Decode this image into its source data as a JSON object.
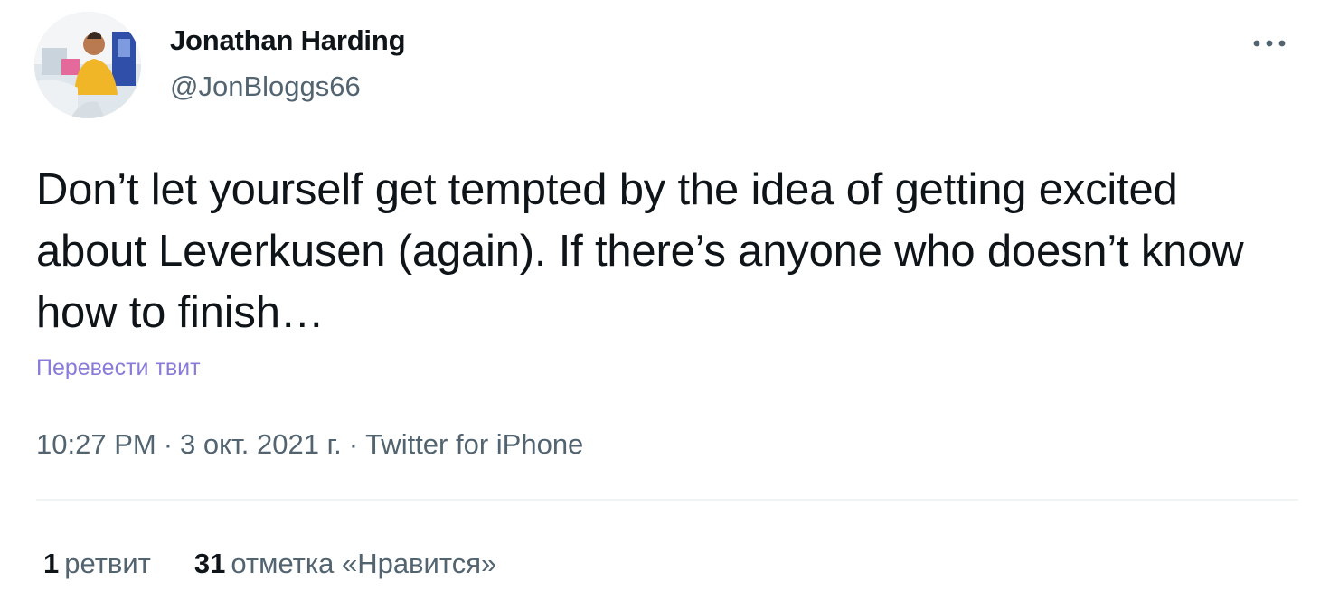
{
  "author": {
    "display_name": "Jonathan Harding",
    "handle": "@JonBloggs66"
  },
  "tweet": {
    "text": "Don’t let yourself get tempted by the idea of getting excited about Leverkusen (again). If there’s anyone who doesn’t know how to finish…",
    "translate_label": "Перевести твит"
  },
  "meta": {
    "time": "10:27 PM",
    "separator": "·",
    "date": "3 окт. 2021 г.",
    "source": "Twitter for iPhone"
  },
  "stats": {
    "retweets": {
      "count": "1",
      "label": "ретвит"
    },
    "likes": {
      "count": "31",
      "label": "отметка «Нравится»"
    }
  },
  "icons": {
    "more": "more-horizontal-icon"
  },
  "colors": {
    "text": "#0f1419",
    "secondary": "#536471",
    "link": "#8a7bd8",
    "divider": "#eff3f4"
  }
}
